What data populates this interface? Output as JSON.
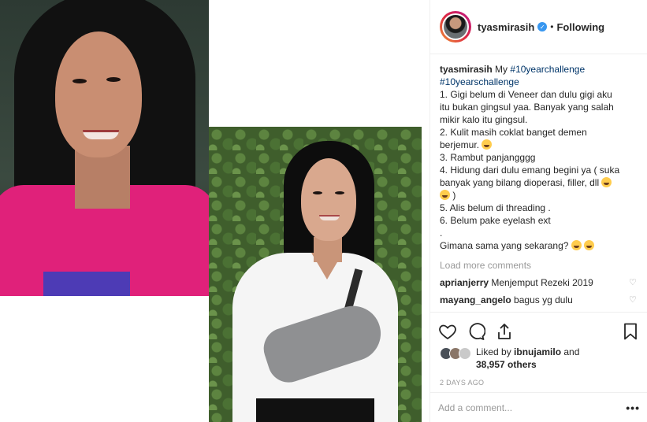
{
  "post": {
    "username": "tyasmirasih",
    "verified_icon": "verified-badge-icon",
    "follow_separator": "•",
    "follow_status": "Following"
  },
  "caption": {
    "username": "tyasmirasih",
    "intro": "My ",
    "hashtag1": "#10yearchallenge",
    "hashtag2": "#10yearschallenge",
    "lines": [
      "1. Gigi belum di Veneer dan dulu gigi aku",
      "itu bukan gingsul yaa. Banyak yang salah",
      "mikir kalo itu gingsul.",
      "2. Kulit masih coklat banget demen",
      "berjemur.",
      "3. Rambut panjangggg",
      "4. Hidung dari dulu emang begini ya ( suka",
      "banyak yang bilang dioperasi, filler, dll",
      ")",
      "5. Alis belum di threading .",
      "6. Belum pake eyelash ext",
      ".",
      "Gimana sama yang sekarang?"
    ]
  },
  "load_more": "Load more comments",
  "comments": [
    {
      "user": "aprianjerry",
      "text": "Menjemput Rezeki 2019"
    },
    {
      "user": "mayang_angelo",
      "text": "bagus yg dulu"
    }
  ],
  "likes": {
    "prefix": "Liked by ",
    "user": "ibnujamilo",
    "and": " and",
    "count": "38,957 others"
  },
  "timestamp": "2 DAYS AGO",
  "add_comment_placeholder": "Add a comment...",
  "more_options": "•••",
  "icons": {
    "like": "heart-icon",
    "comment": "comment-icon",
    "share": "share-icon",
    "save": "bookmark-icon"
  },
  "colors": {
    "link": "#003569",
    "verified": "#3897f0",
    "muted": "#999999"
  }
}
